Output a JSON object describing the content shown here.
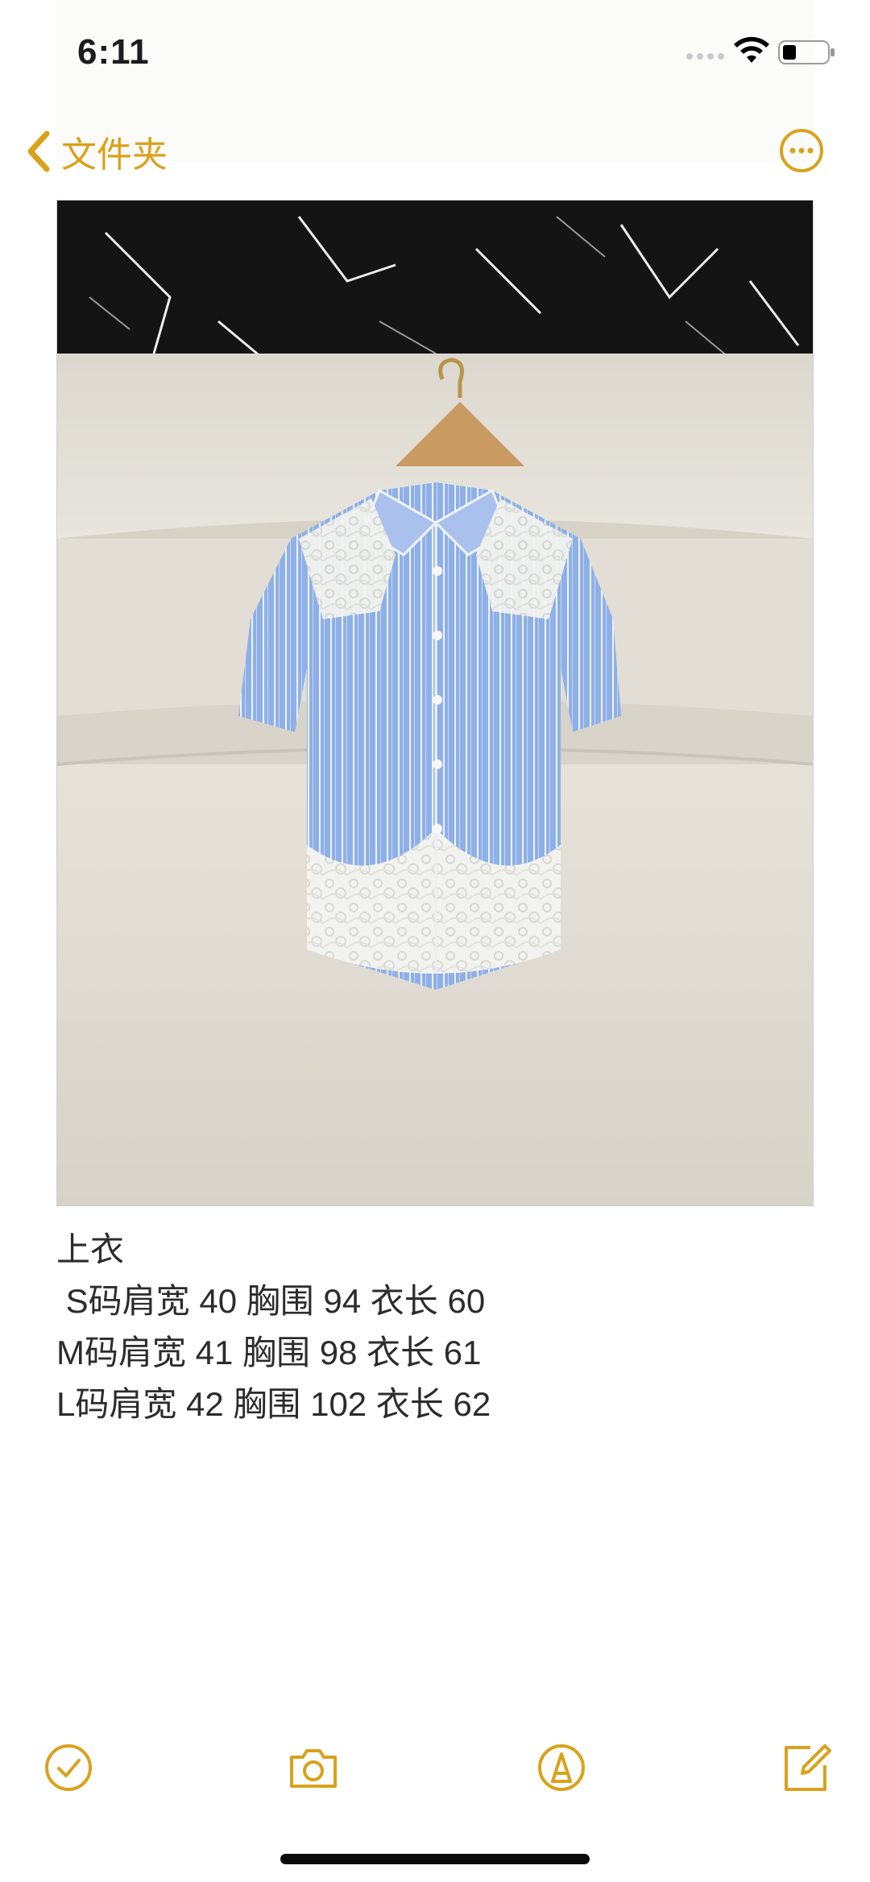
{
  "status_bar": {
    "time": "6:11"
  },
  "nav": {
    "back_label": "文件夹"
  },
  "note": {
    "lines": [
      "上衣",
      " S码肩宽 40 胸围 94 衣长 60",
      "M码肩宽 41 胸围 98 衣长 61",
      "L码肩宽 42 胸围 102 衣长 62"
    ]
  },
  "toolbar": {
    "items": [
      "checklist-icon",
      "camera-icon",
      "markup-icon",
      "compose-icon"
    ]
  },
  "colors": {
    "accent": "#d9a21b",
    "shirt_blue": "#8fb0e6",
    "lace_white": "#f4f4f2",
    "sofa": "#e3dfd6",
    "marble": "#141414"
  }
}
